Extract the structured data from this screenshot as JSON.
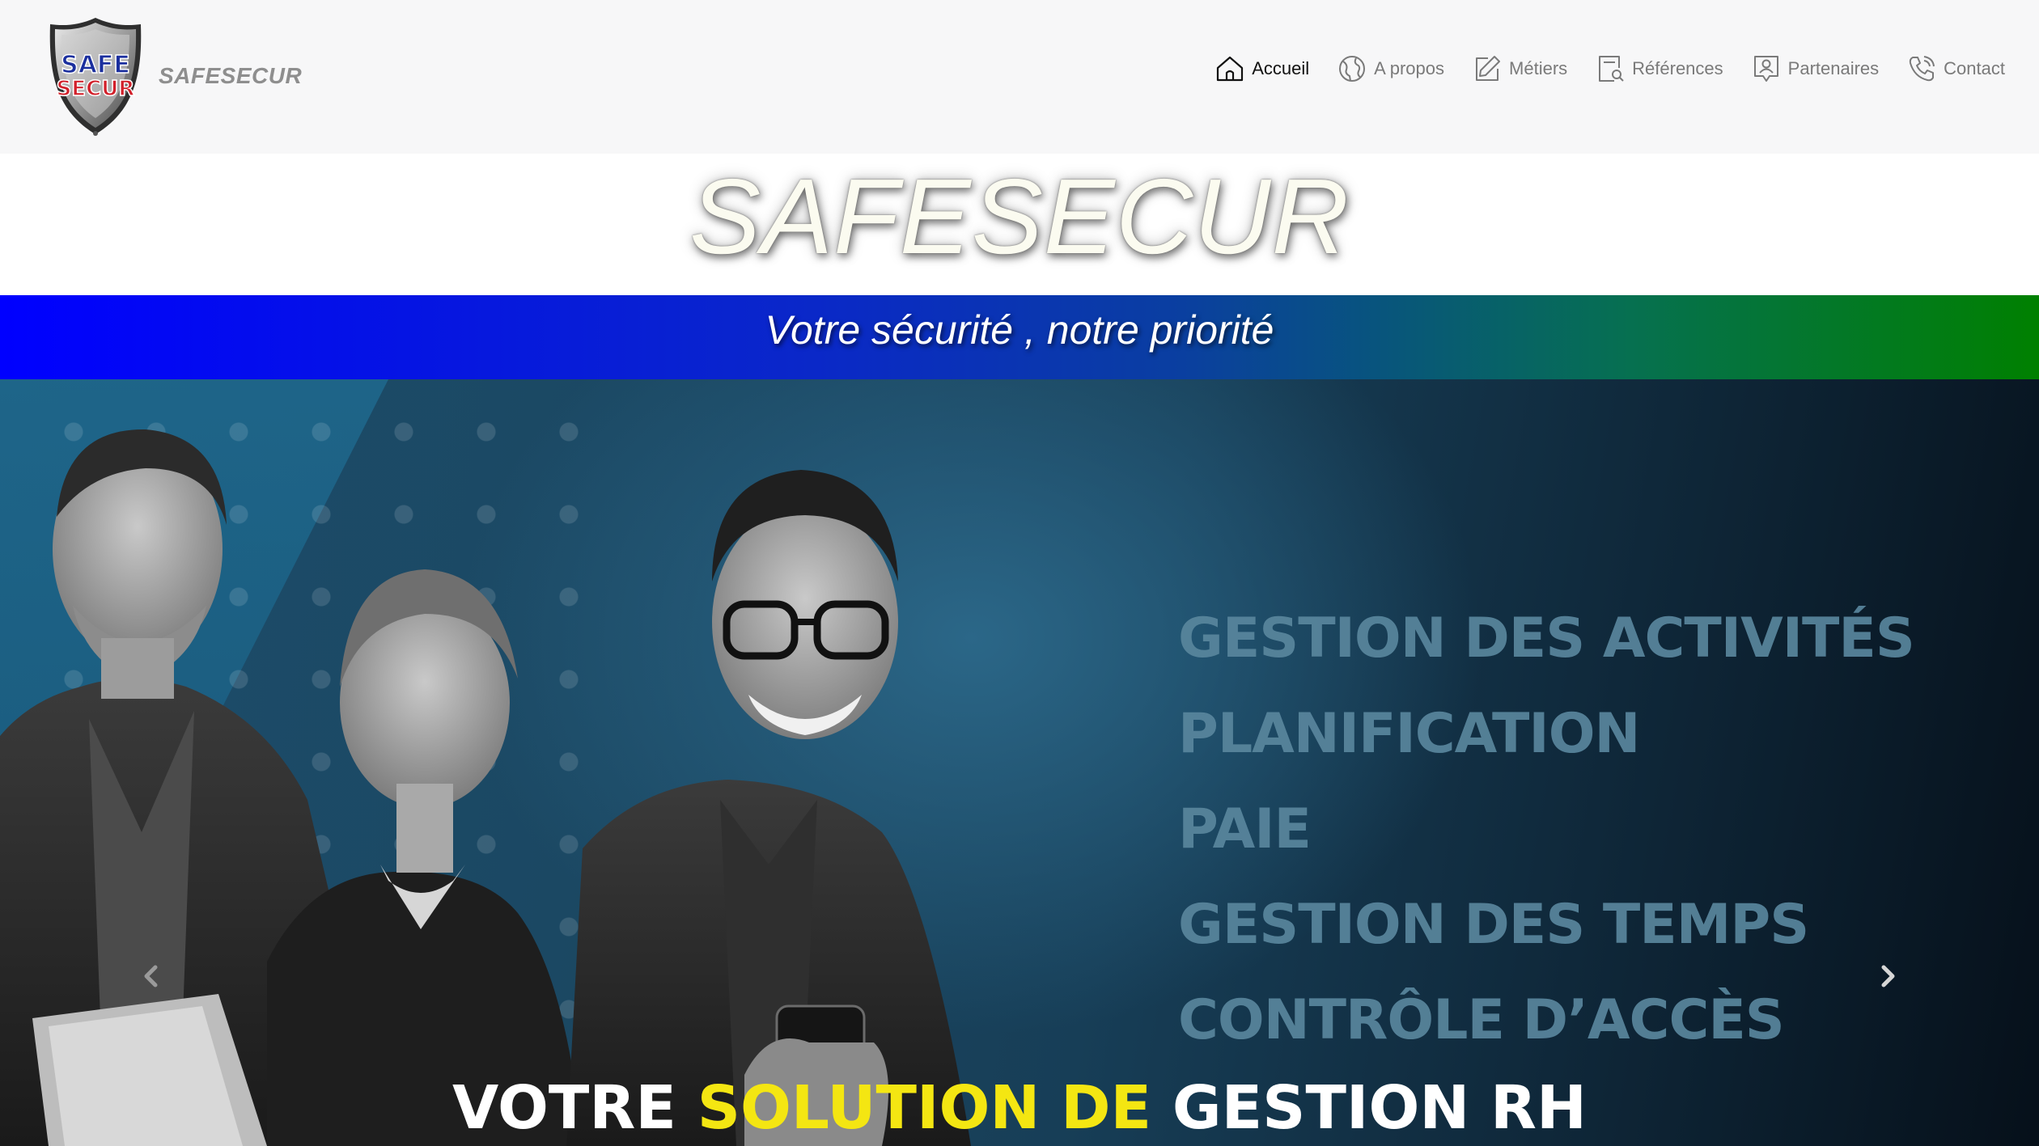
{
  "brand": {
    "name": "SAFESECUR",
    "logo_text_top": "SAFE",
    "logo_text_bottom": "SECUR"
  },
  "nav": {
    "items": [
      {
        "label": "Accueil",
        "icon": "home-icon",
        "active": true
      },
      {
        "label": "A propos",
        "icon": "globe-icon",
        "active": false
      },
      {
        "label": "Métiers",
        "icon": "edit-icon",
        "active": false
      },
      {
        "label": "Références",
        "icon": "document-search-icon",
        "active": false
      },
      {
        "label": "Partenaires",
        "icon": "user-badge-icon",
        "active": false
      },
      {
        "label": "Contact",
        "icon": "phone-icon",
        "active": false
      }
    ]
  },
  "header": {
    "title": "SAFESECUR",
    "slogan": "Votre sécurité , notre priorité"
  },
  "hero": {
    "services": [
      "GESTION DES ACTIVITÉS",
      "PLANIFICATION",
      "PAIE",
      "GESTION DES TEMPS",
      "CONTRÔLE D’ACCÈS"
    ],
    "caption_part1": "VOTRE ",
    "caption_highlight": "SOLUTION DE",
    "caption_part2": " GESTION RH",
    "prev_icon": "chevron-left-icon",
    "next_icon": "chevron-right-icon"
  },
  "colors": {
    "slogan_gradient_start": "#0000ff",
    "slogan_gradient_end": "#008000",
    "caption_highlight": "#f4e612",
    "services_text": "#59869d"
  }
}
